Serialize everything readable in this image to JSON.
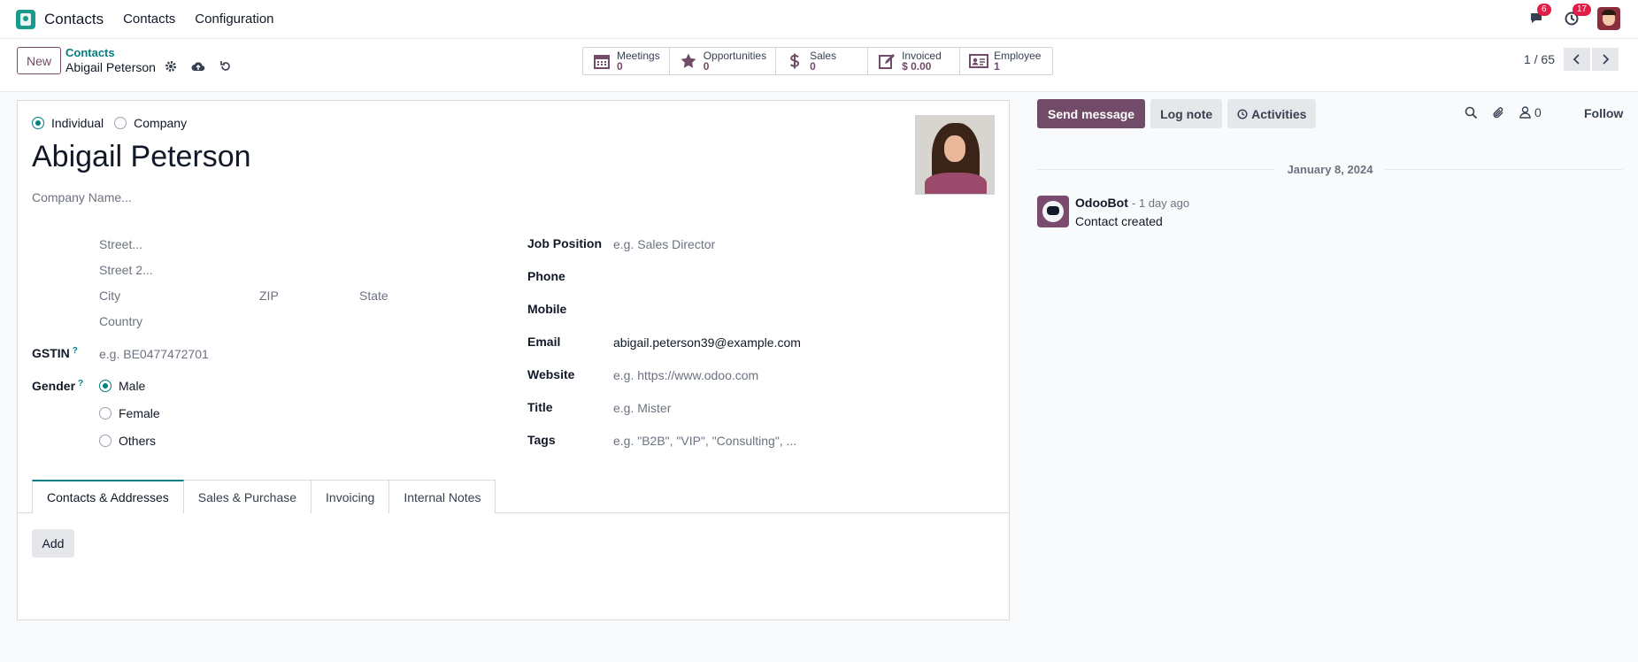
{
  "navbar": {
    "app_name": "Contacts",
    "menu": [
      "Contacts",
      "Configuration"
    ],
    "messages_count": "6",
    "activities_count": "17"
  },
  "control": {
    "new_label": "New",
    "breadcrumb_parent": "Contacts",
    "breadcrumb_current": "Abigail Peterson",
    "pager": "1 / 65"
  },
  "smart_buttons": [
    {
      "label": "Meetings",
      "value": "0",
      "icon": "calendar-icon"
    },
    {
      "label": "Opportunities",
      "value": "0",
      "icon": "star-icon"
    },
    {
      "label": "Sales",
      "value": "0",
      "icon": "dollar-icon"
    },
    {
      "label": "Invoiced",
      "value": "$ 0.00",
      "icon": "edit-icon"
    },
    {
      "label": "Employee",
      "value": "1",
      "icon": "id-card-icon"
    }
  ],
  "form": {
    "type_individual": "Individual",
    "type_company": "Company",
    "name": "Abigail Peterson",
    "company_placeholder": "Company Name...",
    "street_placeholder": "Street...",
    "street2_placeholder": "Street 2...",
    "city_placeholder": "City",
    "zip_placeholder": "ZIP",
    "state_placeholder": "State",
    "country_placeholder": "Country",
    "gstin_label": "GSTIN",
    "gstin_placeholder": "e.g. BE0477472701",
    "gender_label": "Gender",
    "gender_options": [
      "Male",
      "Female",
      "Others"
    ],
    "help_mark": "?",
    "job_position_label": "Job Position",
    "job_position_placeholder": "e.g. Sales Director",
    "phone_label": "Phone",
    "mobile_label": "Mobile",
    "email_label": "Email",
    "email_value": "abigail.peterson39@example.com",
    "website_label": "Website",
    "website_placeholder": "e.g. https://www.odoo.com",
    "title_label": "Title",
    "title_placeholder": "e.g. Mister",
    "tags_label": "Tags",
    "tags_placeholder": "e.g. \"B2B\", \"VIP\", \"Consulting\", ..."
  },
  "tabs": [
    "Contacts & Addresses",
    "Sales & Purchase",
    "Invoicing",
    "Internal Notes"
  ],
  "add_label": "Add",
  "chatter": {
    "send_message": "Send message",
    "log_note": "Log note",
    "activities": "Activities",
    "followers_count": "0",
    "follow": "Follow",
    "date": "January 8, 2024",
    "author": "OdooBot",
    "time": "- 1 day ago",
    "body": "Contact created"
  },
  "colors": {
    "accent": "#714b67",
    "teal": "#017e84"
  }
}
